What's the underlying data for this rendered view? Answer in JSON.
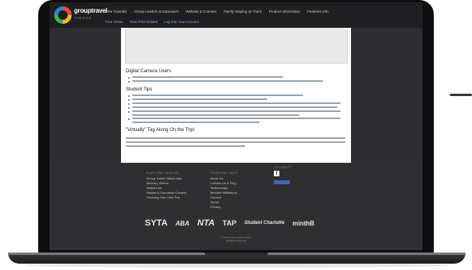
{
  "nav": {
    "logo_text": "grouptravel",
    "logo_sub": "VIDEOS",
    "menu": [
      "Free Tutorials",
      "Group Leaders & Educators",
      "Website & Courses",
      "Family Staying on Track",
      "Product Information",
      "Features Info"
    ],
    "sub": [
      "Free Views",
      "View Print Guides",
      "Log Into Your Account"
    ]
  },
  "content": {
    "h1": "Digital Camera Users",
    "h2": "Student Tips",
    "h3": "\"Virtually\" Tag Along On the Trip!"
  },
  "footer": {
    "col1_title": "EXPLORE VIDEOS",
    "col1_items": [
      "Group Travel Videos App",
      "Itinerary Videos",
      "Watch Live",
      "Stories & Education Content",
      "Planning Your Own Trip"
    ],
    "col2_title": "COMPANY INFO",
    "col2_items": [
      "About Us",
      "Contact Us & FAQ",
      "Testimonials",
      "Member Affiliations",
      "Careers",
      "Terms",
      "Privacy"
    ],
    "col3_title": "CONNECT",
    "fb": "f",
    "logos": [
      "SYTA",
      "ABA",
      "NTA",
      "TAP",
      "Student Charlotte",
      "minthB"
    ],
    "copyright1": "© 2024 Group Travel Videos",
    "copyright2": "All Rights Reserved"
  }
}
